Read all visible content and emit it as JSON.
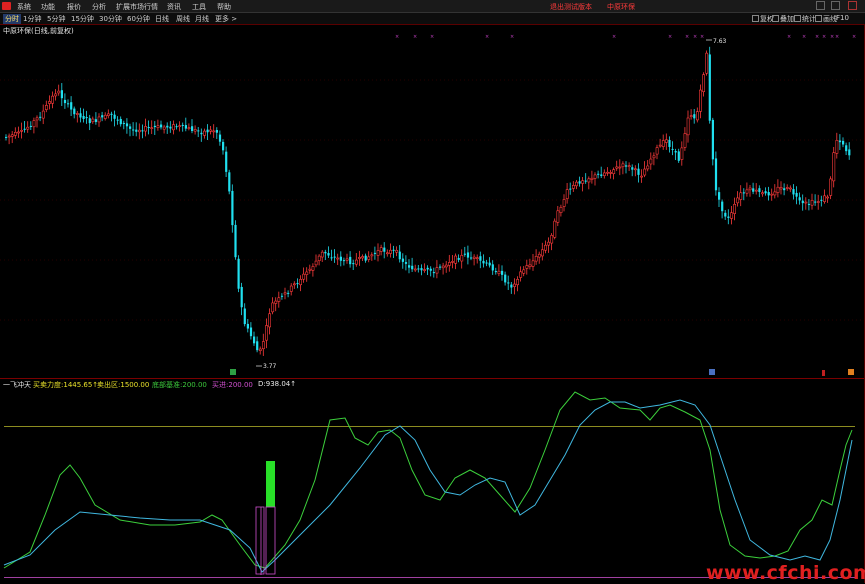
{
  "menu": {
    "items": [
      "系统",
      "功能",
      "报价",
      "分析",
      "扩展市场行情",
      "资讯",
      "工具",
      "帮助"
    ],
    "notice": "退出测试版本",
    "product": "中原环保"
  },
  "toolbar": {
    "tabs": [
      "分时",
      "1分钟",
      "5分钟",
      "15分钟",
      "30分钟",
      "60分钟",
      "日线",
      "周线",
      "月线",
      "更多 >"
    ],
    "active_tab": "分时",
    "right_buttons": [
      "复权",
      "叠加",
      "统计",
      "画线",
      "F10",
      "标记",
      "-"
    ]
  },
  "main_chart": {
    "title": "中原环保(日线,前复权)",
    "high_label": "7.63",
    "low_label": "3.77",
    "up_color": "#ff3b3b",
    "down_color": "#20e0f0"
  },
  "indicator": {
    "name": "一飞冲天",
    "items": [
      {
        "label": "买卖力度:",
        "value": "1445.65↑",
        "color": "#e8e02a"
      },
      {
        "label": "卖出区:",
        "value": "1500.00",
        "color": "#e8e02a"
      },
      {
        "label": "底部基准:",
        "value": "200.00",
        "color": "#3cc83c"
      },
      {
        "label": "买进:",
        "value": "200.00",
        "color": "#d050d0"
      },
      {
        "label": "D:",
        "value": "938.04↑",
        "color": "#e8e8e8"
      }
    ],
    "k_color": "#3cd03c",
    "d_color": "#40b8e0",
    "level_color": "#8c8c20",
    "signal_color": "#28e028"
  },
  "watermark": "www.cfchi.com"
}
